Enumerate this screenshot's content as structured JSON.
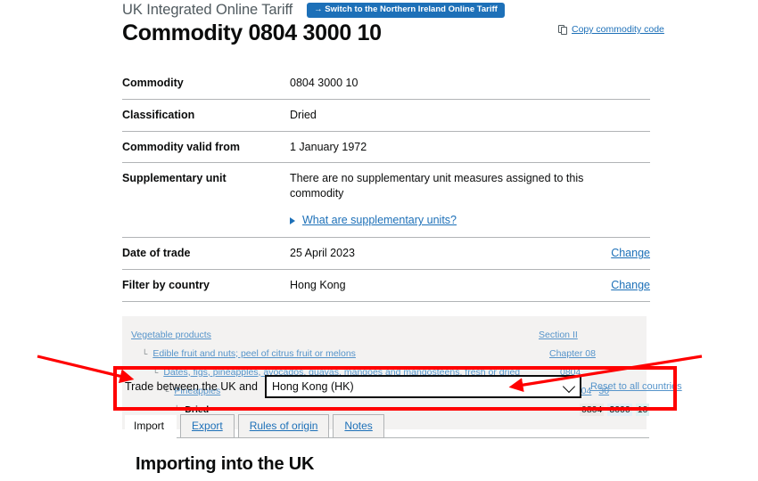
{
  "header": {
    "service_name": "UK Integrated Online Tariff",
    "switch_button": "→ Switch to the Northern Ireland Online Tariff",
    "title": "Commodity 0804 3000 10",
    "copy_link": "Copy commodity code",
    "copy_icon": "copy-icon"
  },
  "details": {
    "rows": [
      {
        "key": "Commodity",
        "value": "0804 3000 10",
        "action": ""
      },
      {
        "key": "Classification",
        "value": "Dried",
        "action": ""
      },
      {
        "key": "Commodity valid from",
        "value": "1 January 1972",
        "action": ""
      },
      {
        "key": "Supplementary unit",
        "value": "There are no supplementary unit measures assigned to this commodity",
        "action": ""
      },
      {
        "key": "Date of trade",
        "value": "25 April 2023",
        "action": "Change"
      },
      {
        "key": "Filter by country",
        "value": "Hong Kong",
        "action": "Change"
      }
    ],
    "supplementary_link": "What are supplementary units?"
  },
  "hierarchy": {
    "rows": [
      {
        "indent": 0,
        "label": "Vegetable products",
        "is_link": true,
        "codes": [
          {
            "text": "Section II",
            "link": true,
            "shade": ""
          }
        ]
      },
      {
        "indent": 1,
        "label": "Edible fruit and nuts; peel of citrus fruit or melons",
        "is_link": true,
        "codes": [
          {
            "text": "Chapter 08",
            "link": true,
            "shade": ""
          }
        ]
      },
      {
        "indent": 2,
        "label": "Dates, figs, pineapples, avocados, guavas, mangoes and mangosteens, fresh or dried",
        "is_link": true,
        "codes": [
          {
            "text": "0804",
            "link": true,
            "shade": ""
          }
        ]
      },
      {
        "indent": 3,
        "label": "Pineapples",
        "is_link": true,
        "codes": [
          {
            "text": "0804",
            "link": true,
            "shade": ""
          },
          {
            "text": "30",
            "link": true,
            "shade": ""
          }
        ]
      },
      {
        "indent": 4,
        "label": "Dried",
        "is_link": false,
        "codes": [
          {
            "text": "0804",
            "link": false,
            "shade": "s0"
          },
          {
            "text": "3000",
            "link": false,
            "shade": "s1"
          },
          {
            "text": "10",
            "link": false,
            "shade": "s2"
          }
        ]
      }
    ]
  },
  "country_selector": {
    "label": "Trade between the UK and",
    "selected": "Hong Kong (HK)",
    "options": [
      "Hong Kong (HK)"
    ],
    "reset_link": "Reset to all countries",
    "chevron_icon": "chevron-down-icon"
  },
  "tabs": {
    "items": [
      {
        "label": "Import",
        "active": true
      },
      {
        "label": "Export",
        "active": false
      },
      {
        "label": "Rules of origin",
        "active": false
      },
      {
        "label": "Notes",
        "active": false
      }
    ],
    "panel_heading": "Importing into the UK"
  },
  "annotation": {
    "highlight_color": "#ff0000",
    "arrows": 2
  }
}
